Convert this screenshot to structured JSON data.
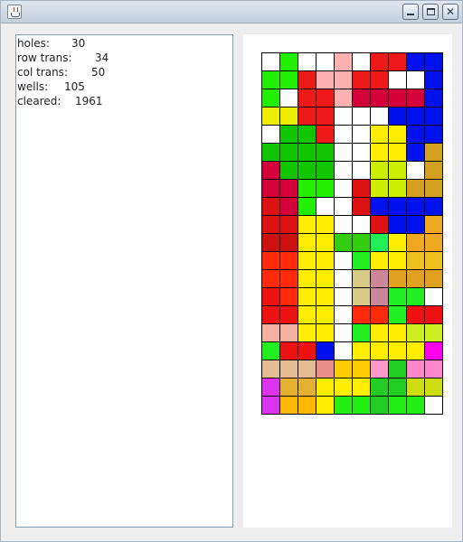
{
  "window": {
    "title": ""
  },
  "stats": [
    {
      "label": "holes:",
      "value": "30"
    },
    {
      "label": "row trans:",
      "value": "34"
    },
    {
      "label": "col trans:",
      "value": "50"
    },
    {
      "label": "wells:",
      "value": "105"
    },
    {
      "label": "cleared:",
      "value": "1961"
    }
  ],
  "board": {
    "columns": 10,
    "rows": 20,
    "cells": [
      [
        "#ffffff",
        "#22ee00",
        "#ffffff",
        "#ffffff",
        "#ffb0b0",
        "#ffffff",
        "#ee1a1a",
        "#ee1a1a",
        "#0011ee",
        "#0011ee"
      ],
      [
        "#22ee00",
        "#22ee00",
        "#ee1a1a",
        "#ffb0b0",
        "#ffb0b0",
        "#ee1a1a",
        "#ee1a1a",
        "#ffffff",
        "#ffffff",
        "#0011ee"
      ],
      [
        "#22ee00",
        "#ffffff",
        "#ee1a1a",
        "#ee1a1a",
        "#ffb0b0",
        "#d4003a",
        "#d4003a",
        "#d4003a",
        "#d4003a",
        "#0011ee"
      ],
      [
        "#eeee00",
        "#eeee00",
        "#ee1a1a",
        "#ee1a1a",
        "#ffffff",
        "#ffffff",
        "#ffffff",
        "#0011ee",
        "#0011ee",
        "#0011ee"
      ],
      [
        "#ffffff",
        "#11c400",
        "#11c400",
        "#ee1a1a",
        "#ffffff",
        "#ffffff",
        "#ffee00",
        "#ffee00",
        "#0011ee",
        "#0011ee"
      ],
      [
        "#11c400",
        "#11c400",
        "#11c400",
        "#11c400",
        "#ffffff",
        "#ffffff",
        "#ffee00",
        "#ffee00",
        "#0011ee",
        "#d4a020"
      ],
      [
        "#d4003a",
        "#11c400",
        "#11c400",
        "#11c400",
        "#ffffff",
        "#ffffff",
        "#ccee00",
        "#ccee00",
        "#ffffff",
        "#d4a020"
      ],
      [
        "#d4003a",
        "#d4003a",
        "#22ee00",
        "#22ee00",
        "#ffffff",
        "#dd1111",
        "#ccee00",
        "#ccee00",
        "#d4a020",
        "#d4a020"
      ],
      [
        "#dd1111",
        "#d4003a",
        "#22ee00",
        "#ffffff",
        "#ffffff",
        "#dd1111",
        "#0011ee",
        "#0011ee",
        "#0011ee",
        "#0011ee"
      ],
      [
        "#dd1111",
        "#dd1111",
        "#ffee00",
        "#ffee00",
        "#ffffff",
        "#ffffff",
        "#dd1111",
        "#0011ee",
        "#0011ee",
        "#f0a820"
      ],
      [
        "#cc1111",
        "#cc1111",
        "#ffee00",
        "#ffee00",
        "#33cc11",
        "#33cc11",
        "#22ee55",
        "#ffee00",
        "#f0a820",
        "#f0a820"
      ],
      [
        "#ff2a0a",
        "#ff2a0a",
        "#ffee00",
        "#ffee00",
        "#ffffff",
        "#22ee22",
        "#ffee00",
        "#ffee00",
        "#f0c020",
        "#f0c020"
      ],
      [
        "#ff2a0a",
        "#ff2a0a",
        "#ffee00",
        "#ffee00",
        "#ffffff",
        "#d8cc88",
        "#cc8899",
        "#e0a020",
        "#e0a020",
        "#e0a020"
      ],
      [
        "#ee1111",
        "#ff2a0a",
        "#ffee00",
        "#ffee00",
        "#ffffff",
        "#d8cc88",
        "#cc8899",
        "#22ee22",
        "#22ee22",
        "#ffffff"
      ],
      [
        "#ee1111",
        "#ee1111",
        "#ffee00",
        "#ffee00",
        "#ffffff",
        "#ff2a0a",
        "#ff2a0a",
        "#22ee22",
        "#ee1111",
        "#ee1111"
      ],
      [
        "#f4b0a0",
        "#f4b0a0",
        "#ffee00",
        "#ffee00",
        "#ffffff",
        "#22ee22",
        "#ffee00",
        "#ffee00",
        "#ccee22",
        "#ccee22"
      ],
      [
        "#22ee22",
        "#ee1111",
        "#ee1111",
        "#0011ee",
        "#ffffff",
        "#ffee00",
        "#ffee00",
        "#ffee00",
        "#ffee00",
        "#ff00ee"
      ],
      [
        "#e4bc94",
        "#e4bc94",
        "#e4bc94",
        "#e89088",
        "#ffcc00",
        "#ffcc00",
        "#ff99cc",
        "#22cc22",
        "#ff88cc",
        "#ff88cc"
      ],
      [
        "#dd33ee",
        "#e4b030",
        "#e4b030",
        "#ffee00",
        "#ffee00",
        "#ffee00",
        "#22cc22",
        "#22cc22",
        "#ccdd11",
        "#ccdd11"
      ],
      [
        "#dd33ee",
        "#ffb800",
        "#ffb800",
        "#ffee00",
        "#22ee11",
        "#22ee11",
        "#22cc22",
        "#22ee11",
        "#22ee11",
        "#ffffff"
      ]
    ]
  },
  "icons": {
    "app": "java-coffee-cup-icon",
    "minimize": "minimize-icon",
    "maximize": "maximize-icon",
    "close": "close-icon"
  }
}
